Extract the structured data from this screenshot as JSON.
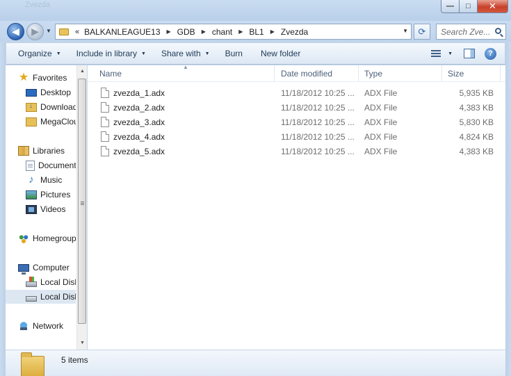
{
  "window": {
    "title": "Zvezda",
    "buttons": {
      "minimize": "—",
      "maximize": "□",
      "close": "✕"
    }
  },
  "address": {
    "overflow": "«",
    "crumbs": [
      "BALKANLEAGUE13",
      "GDB",
      "chant",
      "BL1",
      "Zvezda"
    ],
    "search_placeholder": "Search Zve..."
  },
  "toolbar": {
    "organize": "Organize",
    "include_in_library": "Include in library",
    "share_with": "Share with",
    "burn": "Burn",
    "new_folder": "New folder",
    "help": "?"
  },
  "nav": {
    "favorites": "Favorites",
    "desktop": "Desktop",
    "downloads": "Downloads",
    "megacloud": "MegaCloud",
    "libraries": "Libraries",
    "documents": "Documents",
    "music": "Music",
    "pictures": "Pictures",
    "videos": "Videos",
    "homegroup": "Homegroup",
    "computer": "Computer",
    "local_disk_c": "Local Disk (C:)",
    "local_disk_d": "Local Disk (D:)",
    "network": "Network"
  },
  "columns": {
    "name": "Name",
    "date": "Date modified",
    "type": "Type",
    "size": "Size"
  },
  "files": [
    {
      "name": "zvezda_1.adx",
      "date": "11/18/2012 10:25 ...",
      "type": "ADX File",
      "size": "5,935 KB"
    },
    {
      "name": "zvezda_2.adx",
      "date": "11/18/2012 10:25 ...",
      "type": "ADX File",
      "size": "4,383 KB"
    },
    {
      "name": "zvezda_3.adx",
      "date": "11/18/2012 10:25 ...",
      "type": "ADX File",
      "size": "5,830 KB"
    },
    {
      "name": "zvezda_4.adx",
      "date": "11/18/2012 10:25 ...",
      "type": "ADX File",
      "size": "4,824 KB"
    },
    {
      "name": "zvezda_5.adx",
      "date": "11/18/2012 10:25 ...",
      "type": "ADX File",
      "size": "4,383 KB"
    }
  ],
  "status": {
    "item_count": "5 items"
  },
  "icons": {
    "back": "back-arrow-icon",
    "forward": "forward-arrow-icon",
    "refresh": "refresh-icon",
    "search": "search-icon",
    "views": "views-icon",
    "preview_pane": "preview-pane-icon",
    "help": "help-icon"
  }
}
